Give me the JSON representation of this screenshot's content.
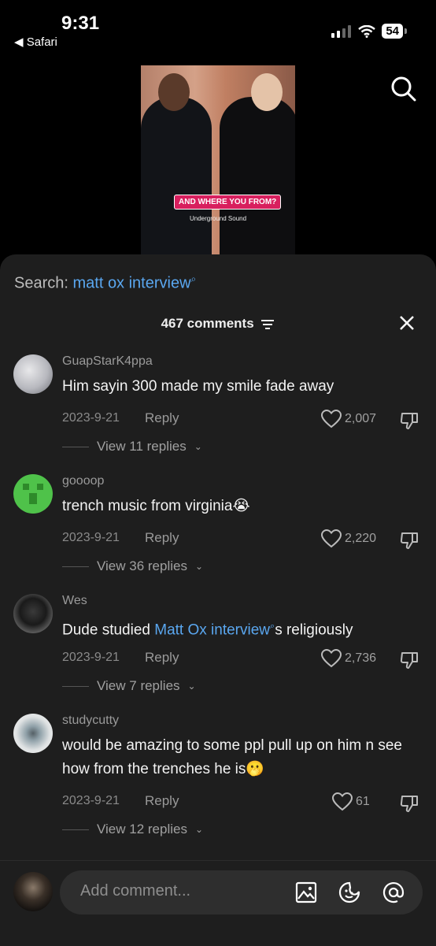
{
  "status": {
    "time": "9:31",
    "back_label": "◀ Safari",
    "battery": "54"
  },
  "video": {
    "caption": "AND WHERE YOU FROM?",
    "subtitle": "Underground Sound"
  },
  "search": {
    "prefix": "Search: ",
    "query": "matt ox interview"
  },
  "comments_header": {
    "count_label": "467 comments"
  },
  "comments": [
    {
      "user": "GuapStarK4ppa",
      "text": "Him sayin 300 made my smile fade away",
      "date": "2023-9-21",
      "reply": "Reply",
      "likes": "2,007",
      "view_replies": "View 11 replies"
    },
    {
      "user": "goooop",
      "text": "trench music from virginia😭",
      "date": "2023-9-21",
      "reply": "Reply",
      "likes": "2,220",
      "view_replies": "View 36 replies"
    },
    {
      "user": "Wes",
      "text_before": "Dude studied ",
      "text_link": "Matt Ox interview",
      "text_after": "s religiously",
      "date": "2023-9-21",
      "reply": "Reply",
      "likes": "2,736",
      "view_replies": "View 7 replies"
    },
    {
      "user": "studycutty",
      "text": "would be amazing to some ppl pull up on him n see how from the trenches he is🫢",
      "date": "2023-9-21",
      "reply": "Reply",
      "likes": "61",
      "view_replies": "View 12 replies"
    }
  ],
  "composer": {
    "placeholder": "Add comment..."
  },
  "colors": {
    "accent_link": "#5aa7f0",
    "sheet_bg": "#1e1e1e",
    "caption_bg": "#d81f5e"
  }
}
